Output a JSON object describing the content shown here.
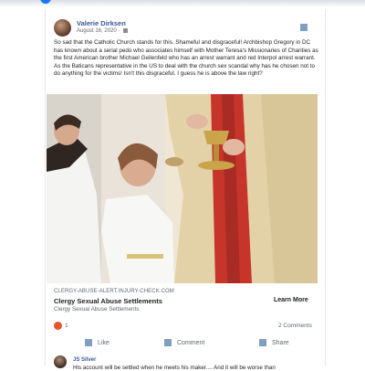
{
  "post": {
    "author": "Valerie Dirksen",
    "date": "August 16, 2020 ·",
    "text": "So sad that the Catholic Church stands for this.  Shameful and disgraceful!  Archbishop Gregory in DC has known about a serial pedo who associates himself with Mother Teresa's Missionaries of Charities as the first American brother Michael Geilenfeld who has an arrest warrant and red Interpol arrest warrant.  As the Baticans representative in the US to deal with the church sex scandal why has he chosen not to do anything for the victims!  Isn't this disgraceful.  I guess he is above the law right?"
  },
  "link": {
    "domain": "CLERGY-ABUSE-ALERT.INJURY-CHECK.COM",
    "title": "Clergy Sexual Abuse Settlements",
    "subtitle": "Clergy Sexual Abuse Settlements",
    "cta": "Learn More"
  },
  "stats": {
    "reactions": "1",
    "comments": "2 Comments"
  },
  "actions": {
    "like": "Like",
    "comment": "Comment",
    "share": "Share"
  },
  "comment": {
    "author": "JS Silver",
    "text": "His account will be settled when he meets his maker.... And it will be worse than"
  },
  "icons": {
    "brand": "facebook-logo-icon",
    "privacy": "globe-icon",
    "more": "more-options-icon",
    "reaction": "angry-reaction-icon",
    "like": "like-icon",
    "comment": "comment-icon",
    "share": "share-icon"
  },
  "colors": {
    "brand": "#1877f2",
    "name_link": "#385898",
    "reaction": "#e4572e",
    "icon_placeholder": "#7f9fc0"
  }
}
